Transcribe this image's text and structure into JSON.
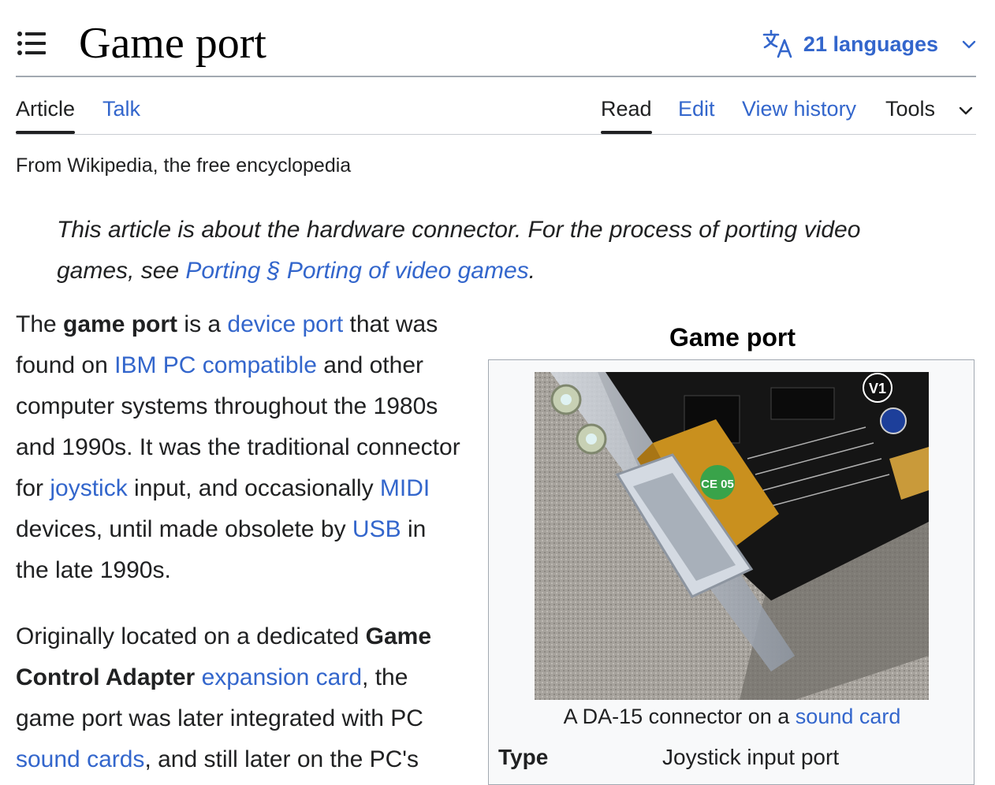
{
  "header": {
    "title": "Game port",
    "languages_label": "21 languages"
  },
  "tabs": {
    "article": "Article",
    "talk": "Talk",
    "read": "Read",
    "edit": "Edit",
    "view_history": "View history",
    "tools": "Tools"
  },
  "tagline": "From Wikipedia, the free encyclopedia",
  "hatnote": {
    "text": "This article is about the hardware connector. For the process of porting video games, see ",
    "link": "Porting § Porting of video games",
    "end": "."
  },
  "paragraph1": {
    "t1": "The ",
    "b1": "game port",
    "t2": " is a ",
    "l1": "device port",
    "t3": " that was found on ",
    "l2": "IBM PC compatible",
    "t4": " and other computer systems throughout the 1980s and 1990s. It was the traditional connector for ",
    "l3": "joystick",
    "t5": " input, and occasionally ",
    "l4": "MIDI",
    "t6": " devices, until made obsolete by ",
    "l5": "USB",
    "t7": " in the late 1990s."
  },
  "paragraph2": {
    "t1": "Originally located on a dedicated ",
    "b1": "Game Control Adapter",
    "t2": " ",
    "l1": "expansion card",
    "t3": ", the game port was later integrated with PC ",
    "l2": "sound cards",
    "t4": ", and still later on the PC's"
  },
  "infobox": {
    "title": "Game port",
    "image_label": "V1",
    "image_badge": "CE 05",
    "caption_text": "A DA-15 connector on a ",
    "caption_link": "sound card",
    "row_label": "Type",
    "row_value": "Joystick input port"
  },
  "colors": {
    "link": "#3366cc",
    "text": "#202122",
    "rule": "#a2a9b1",
    "infobox_bg": "#f8f9fa"
  },
  "icons": {
    "toc": "list-icon",
    "language": "translate-icon",
    "chevron": "chevron-down-icon"
  }
}
